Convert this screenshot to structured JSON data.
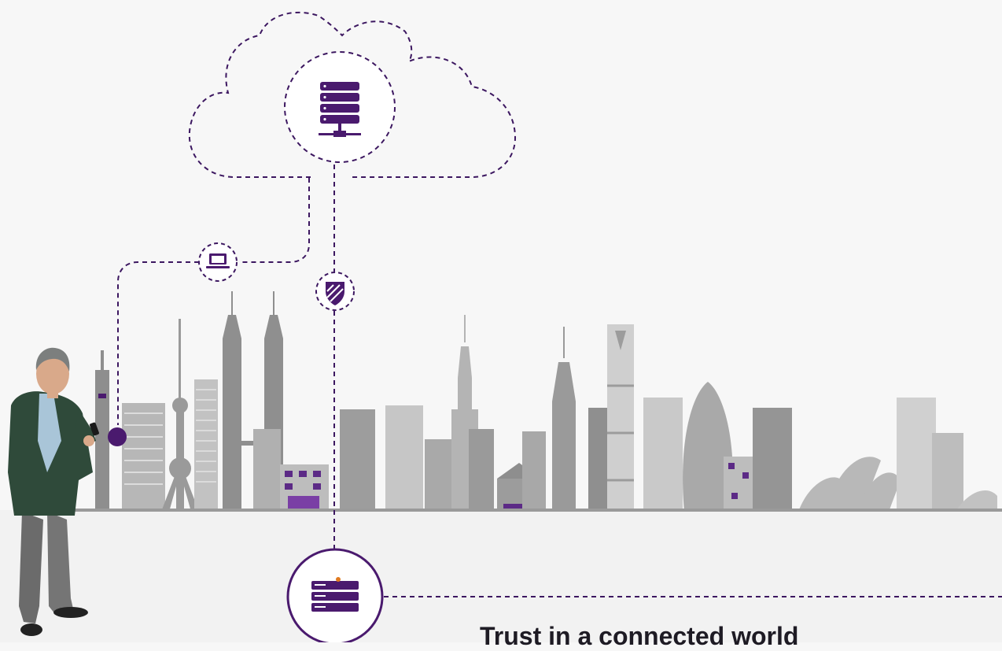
{
  "headline": "Trust in a connected world",
  "colors": {
    "brand_purple": "#4a1a6e",
    "dash_purple": "#3c1760",
    "building_gray": "#9c9c9c",
    "background": "#f7f7f7"
  },
  "icons": {
    "cloud": "cloud-outline-icon",
    "server": "server-stack-icon",
    "laptop": "laptop-icon",
    "shield": "shield-icon",
    "hsm": "hardware-appliance-icon"
  }
}
